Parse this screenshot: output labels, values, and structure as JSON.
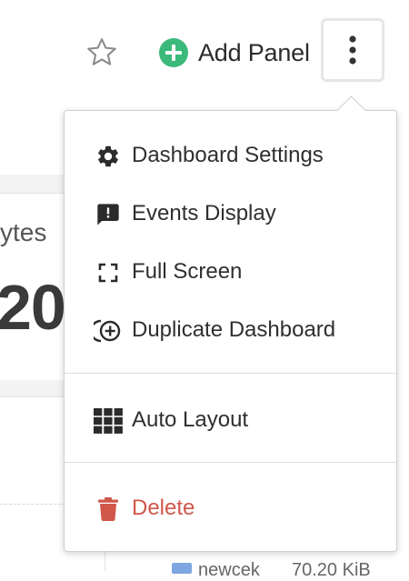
{
  "toolbar": {
    "star_icon": "star-outline-icon",
    "add_panel_label": "Add Panel",
    "add_panel_icon": "plus-circle-icon",
    "more_icon": "kebab-vertical-icon"
  },
  "menu": {
    "items": [
      {
        "label": "Dashboard Settings",
        "icon": "gear-icon"
      },
      {
        "label": "Events Display",
        "icon": "message-alert-icon"
      },
      {
        "label": "Full Screen",
        "icon": "fullscreen-icon"
      },
      {
        "label": "Duplicate Dashboard",
        "icon": "duplicate-plus-icon"
      },
      {
        "label": "Auto Layout",
        "icon": "grid-icon"
      },
      {
        "label": "Delete",
        "icon": "trash-icon"
      }
    ]
  },
  "background": {
    "panel_unit": "ytes",
    "panel_value": "20.",
    "legend_name": "newcek",
    "legend_value": "70.20 KiB"
  },
  "colors": {
    "accent_green": "#3bb97a",
    "danger_red": "#d0574a",
    "legend_blue": "#7ea6e0"
  }
}
